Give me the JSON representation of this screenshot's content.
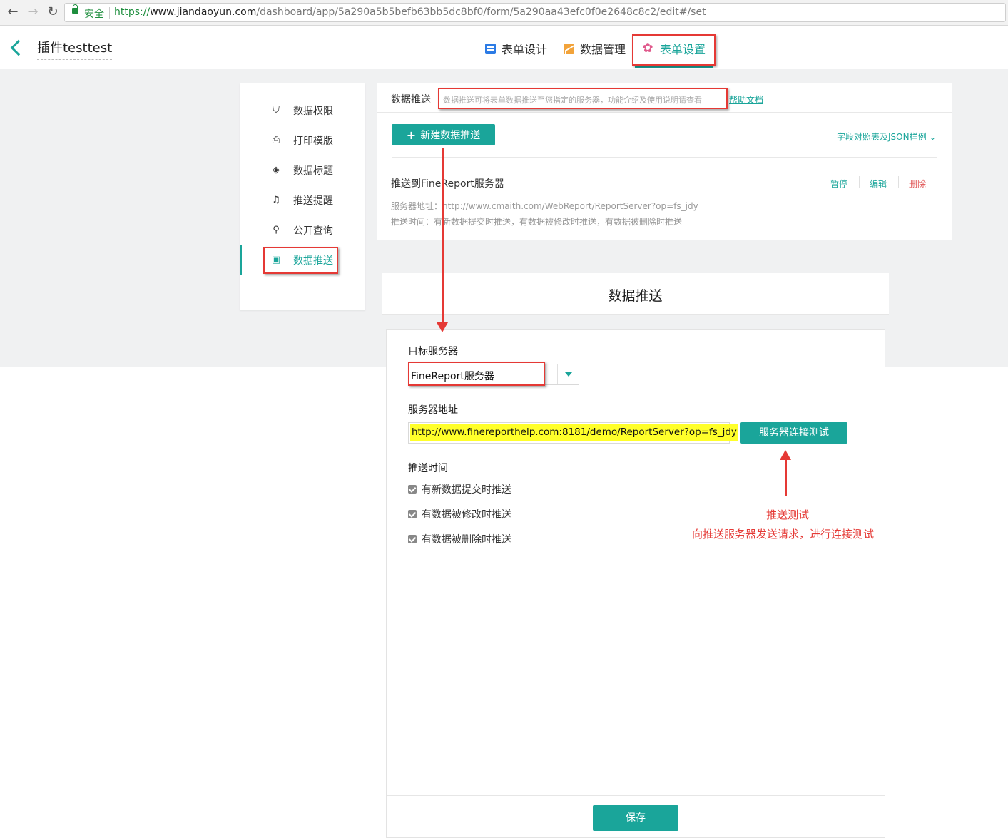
{
  "browser": {
    "secure_label": "安全",
    "url_scheme": "https://",
    "url_host": "www.jiandaoyun.com",
    "url_path": "/dashboard/app/5a290a5b5befb63bb5dc8bf0/form/5a290aa43efc0f0e2648c8c2/edit#/set",
    "back_glyph": "←",
    "forward_glyph": "→",
    "reload_glyph": "↻"
  },
  "header": {
    "app_title": "插件testtest",
    "tabs": [
      {
        "label": "表单设计",
        "icon": "form-icon"
      },
      {
        "label": "数据管理",
        "icon": "chart-icon"
      },
      {
        "label": "表单设置",
        "icon": "gear-icon",
        "active": true
      }
    ]
  },
  "sidebar": {
    "items": [
      {
        "label": "数据权限",
        "icon": "shield-icon",
        "glyph": "⛉"
      },
      {
        "label": "打印模版",
        "icon": "printer-icon",
        "glyph": "⎙"
      },
      {
        "label": "数据标题",
        "icon": "tag-icon",
        "glyph": "◈"
      },
      {
        "label": "推送提醒",
        "icon": "bell-icon",
        "glyph": "♫"
      },
      {
        "label": "公开查询",
        "icon": "search-icon",
        "glyph": "⚲"
      },
      {
        "label": "数据推送",
        "icon": "chart-box-icon",
        "glyph": "▣",
        "active": true
      }
    ]
  },
  "push_panel": {
    "title": "数据推送",
    "description": "数据推送可将表单数据推送至您指定的服务器，功能介绍及使用说明请查看",
    "help_link": "帮助文档",
    "new_button": "新建数据推送",
    "json_link": "字段对照表及JSON样例 ⌄",
    "item": {
      "title": "推送到FineReport服务器",
      "actions": {
        "pause": "暂停",
        "edit": "编辑",
        "delete": "删除"
      },
      "server_line": "服务器地址：http://www.cmaith.com/WebReport/ReportServer?op=fs_jdy",
      "time_line": "推送时间：有新数据提交时推送，有数据被修改时推送，有数据被删除时推送"
    }
  },
  "dialog": {
    "title": "数据推送",
    "target_label": "目标服务器",
    "target_value": "FineReport服务器",
    "address_label": "服务器地址",
    "address_value": "http://www.finereporthelp.com:8181/demo/ReportServer?op=fs_jdy",
    "test_button": "服务器连接测试",
    "time_label": "推送时间",
    "options": [
      {
        "label": "有新数据提交时推送",
        "checked": true
      },
      {
        "label": "有数据被修改时推送",
        "checked": true
      },
      {
        "label": "有数据被删除时推送",
        "checked": true
      }
    ],
    "save_button": "保存"
  },
  "annotation": {
    "line1": "推送测试",
    "line2": "向推送服务器发送请求，进行连接测试"
  },
  "colors": {
    "accent": "#1aa59a",
    "annotation": "#e53935",
    "highlight": "#ffff2a",
    "danger": "#e05353"
  }
}
